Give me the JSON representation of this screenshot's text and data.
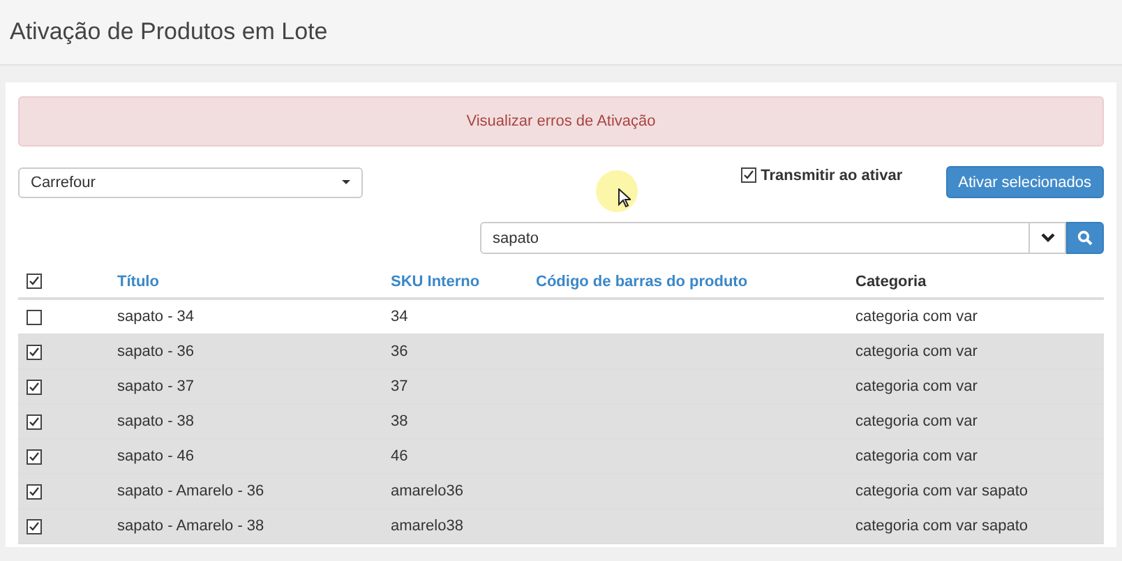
{
  "page": {
    "title": "Ativação de Produtos em Lote"
  },
  "alert": {
    "text": "Visualizar erros de Ativação"
  },
  "marketplace_select": {
    "value": "Carrefour"
  },
  "transmit_option": {
    "label": "Transmitir ao ativar",
    "checked": true
  },
  "activate_button": {
    "label": "Ativar selecionados"
  },
  "search": {
    "value": "sapato"
  },
  "table": {
    "select_all": {
      "checked": true
    },
    "columns": [
      {
        "label": "Título",
        "sortable": true
      },
      {
        "label": "SKU Interno",
        "sortable": true
      },
      {
        "label": "Código de barras do produto",
        "sortable": true
      },
      {
        "label": "Categoria",
        "sortable": false
      }
    ],
    "rows": [
      {
        "checked": false,
        "cells": [
          "sapato - 34",
          "34",
          "",
          "categoria com var"
        ]
      },
      {
        "checked": true,
        "cells": [
          "sapato - 36",
          "36",
          "",
          "categoria com var"
        ]
      },
      {
        "checked": true,
        "cells": [
          "sapato - 37",
          "37",
          "",
          "categoria com var"
        ]
      },
      {
        "checked": true,
        "cells": [
          "sapato - 38",
          "38",
          "",
          "categoria com var"
        ]
      },
      {
        "checked": true,
        "cells": [
          "sapato - 46",
          "46",
          "",
          "categoria com var"
        ]
      },
      {
        "checked": true,
        "cells": [
          "sapato - Amarelo - 36",
          "amarelo36",
          "",
          "categoria com var sapato"
        ]
      },
      {
        "checked": true,
        "cells": [
          "sapato - Amarelo - 38",
          "amarelo38",
          "",
          "categoria com var sapato"
        ]
      }
    ]
  }
}
